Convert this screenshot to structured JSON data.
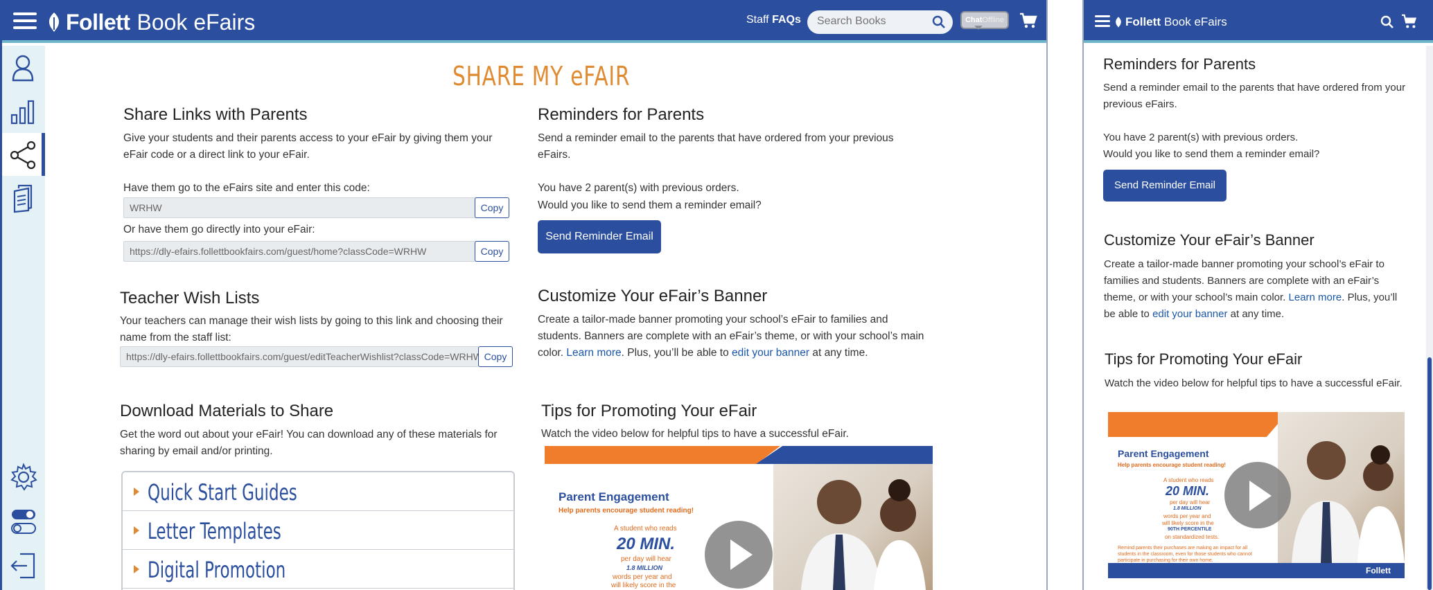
{
  "desktop": {
    "brand": {
      "name": "Follett",
      "product": "Book eFairs"
    },
    "header": {
      "staff_faqs_prefix": "Staff ",
      "staff_faqs_bold": "FAQs",
      "search_placeholder": "Search Books",
      "chat_label": "Chat",
      "chat_status": "Offline"
    },
    "page_title": "SHARE MY eFAIR",
    "share_links": {
      "title": "Share Links with Parents",
      "description": "Give your students and their parents access to your eFair by giving them your eFair code or a direct link to your eFair.",
      "code_label": "Have them go to the eFairs site and enter this code:",
      "code_value": "WRHW",
      "link_label": "Or have them go directly into your eFair:",
      "link_value": "https://dly-efairs.follettbookfairs.com/guest/home?classCode=WRHW",
      "copy_label": "Copy"
    },
    "wish_lists": {
      "title": "Teacher Wish Lists",
      "description": "Your teachers can manage their wish lists by going to this link and choosing their name from the staff list:",
      "link_value": "https://dly-efairs.follettbookfairs.com/guest/editTeacherWishlist?classCode=WRHW",
      "copy_label": "Copy"
    },
    "download": {
      "title": "Download Materials to Share",
      "description": "Get the word out about your eFair! You can download any of these materials for sharing by email and/or printing.",
      "items": [
        "Quick Start Guides",
        "Letter Templates",
        "Digital Promotion"
      ]
    },
    "reminders": {
      "title": "Reminders for Parents",
      "description": "Send a reminder email to the parents that have ordered from your previous eFairs.",
      "count_text": "You have 2 parent(s) with previous orders.",
      "question": "Would you like to send them a reminder email?",
      "button_label": "Send Reminder Email"
    },
    "banner": {
      "title": "Customize Your eFair’s Banner",
      "text_a": "Create a tailor-made banner promoting your school’s eFair to families and students. Banners are complete with an eFair’s theme, or with your school’s main color.",
      "learn_more": "Learn more",
      "text_b": ". Plus, you’ll be able to",
      "edit_link": "edit your banner",
      "text_c": "at any time."
    },
    "tips": {
      "title": "Tips for Promoting Your eFair",
      "description": "Watch the video below for helpful tips to have a successful eFair."
    },
    "video": {
      "heading": "Parent Engagement",
      "subheading": "Help parents encourage student reading!",
      "line1": "A student who reads",
      "big": "20 MIN.",
      "line2": "per day will hear",
      "million": "1.8 MILLION",
      "line3": "words per year and",
      "line4": "will likely score in the"
    }
  },
  "mobile": {
    "brand": {
      "name": "Follett",
      "product": "Book eFairs"
    },
    "reminders": {
      "title": "Reminders for Parents",
      "description": "Send a reminder email to the parents that have ordered from your previous eFairs.",
      "count_text": "You have 2 parent(s) with previous orders.",
      "question": "Would you like to send them a reminder email?",
      "button_label": "Send Reminder Email"
    },
    "banner": {
      "title": "Customize Your eFair’s Banner",
      "text_a": "Create a tailor-made banner promoting your school’s eFair to families and  students. Banners are complete with an eFair’s theme, or with your school’s main color.",
      "learn_more": "Learn more",
      "text_b": ". Plus, you’ll be able to",
      "edit_link": "edit your banner",
      "text_c": "at any time."
    },
    "tips": {
      "title": "Tips for Promoting Your eFair",
      "description": "Watch the video below for helpful tips to have a successful eFair."
    },
    "video": {
      "heading": "Parent Engagement",
      "subheading": "Help parents encourage student reading!",
      "line1": "A student who reads",
      "big": "20 MIN.",
      "line2": "per day will hear",
      "million": "1.8 MILLION",
      "line3": "words per year and",
      "line4": "will likely score in the",
      "percentile": "90TH PERCENTILE",
      "line5": "on standardized tests.",
      "footnote": "Remind parents their purchases are making an impact for all students in the classroom, even for those students who cannot participate in purchasing for their own home.",
      "logo": "Follett"
    }
  },
  "colors": {
    "brand_blue": "#2b4f9e",
    "accent_orange": "#e08a32",
    "sidebar_bg": "#e4f2f6",
    "link": "#1a56a8"
  }
}
